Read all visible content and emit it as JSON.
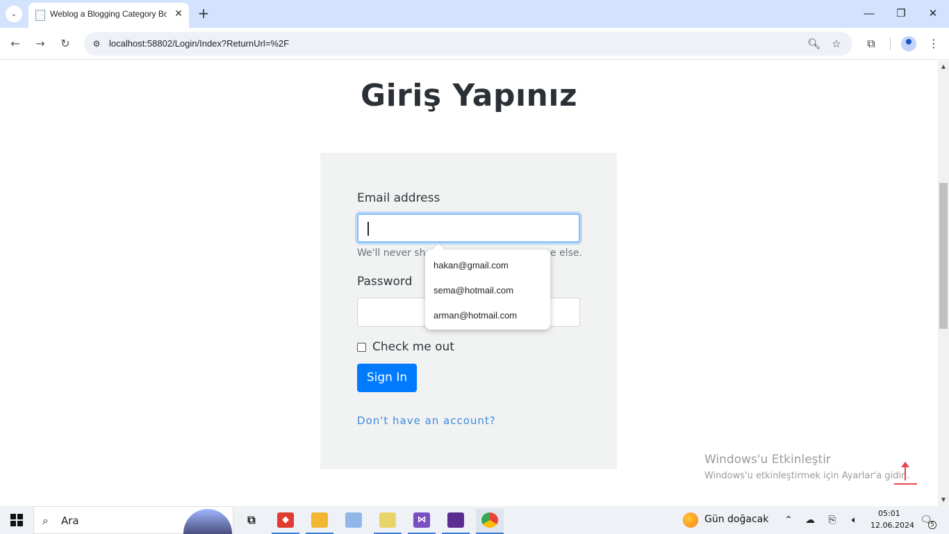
{
  "browser": {
    "tab_title": "Weblog a Blogging Category Bootstrap",
    "url": "localhost:58802/Login/Index?ReturnUrl=%2F"
  },
  "page": {
    "heading": "Giriş Yapınız",
    "email_label": "Email address",
    "email_value": "",
    "email_help_start": "We'll never sho",
    "email_help_end": "e else.",
    "password_label": "Password",
    "remember_label": "Check me out",
    "signin_label": "Sign In",
    "register_link": "Don't have an account?"
  },
  "autofill": {
    "suggestions": [
      "hakan@gmail.com",
      "sema@hotmail.com",
      "arman@hotmail.com"
    ]
  },
  "watermark": {
    "title": "Windows'u Etkinleştir",
    "subtitle": "Windows'u etkinleştirmek için Ayarlar'a gidin."
  },
  "taskbar": {
    "search_placeholder": "Ara",
    "weather": "Gün doğacak",
    "time": "05:01",
    "date": "12.06.2024",
    "notification_count": "5"
  },
  "colors": {
    "primary_button": "#007bff",
    "link": "#3d8bde",
    "card_bg": "#f1f2f2",
    "accent_red": "#e8434f"
  }
}
